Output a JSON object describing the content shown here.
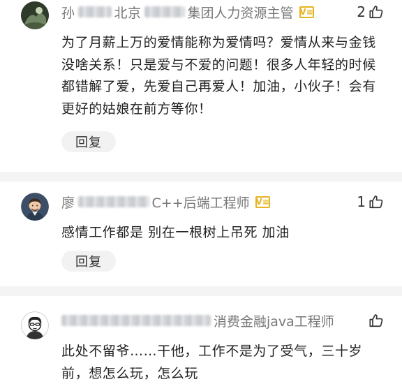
{
  "comments": [
    {
      "author_visible": "孙",
      "author_visible_2": "北京",
      "title": "集团人力资源主管",
      "badge": "V≡",
      "likes": "2",
      "body": "为了月薪上万的爱情能称为爱情吗？爱情从来与金钱没啥关系！只是爱与不爱的问题！很多人年轻的时候都错解了爱，先爱自己再爱人！加油，小伙子！会有更好的姑娘在前方等你！",
      "reply_label": "回复"
    },
    {
      "author_visible": "廖",
      "title": "C++后端工程师",
      "badge": "V≡",
      "likes": "1",
      "body": "感情工作都是 别在一根树上吊死 加油",
      "reply_label": "回复"
    },
    {
      "title": "消费金融java工程师",
      "likes": "",
      "body": "此处不留爷……干他，工作不是为了受气，三十岁前，想怎么玩，怎么玩"
    }
  ],
  "icons": {
    "like": "thumbs-up-icon",
    "badge": "verified-badge-icon"
  },
  "colors": {
    "badge": "#e6b422",
    "meta_text": "#777777",
    "divider": "#f4f4f4",
    "reply_bg": "#f2f2f2"
  }
}
